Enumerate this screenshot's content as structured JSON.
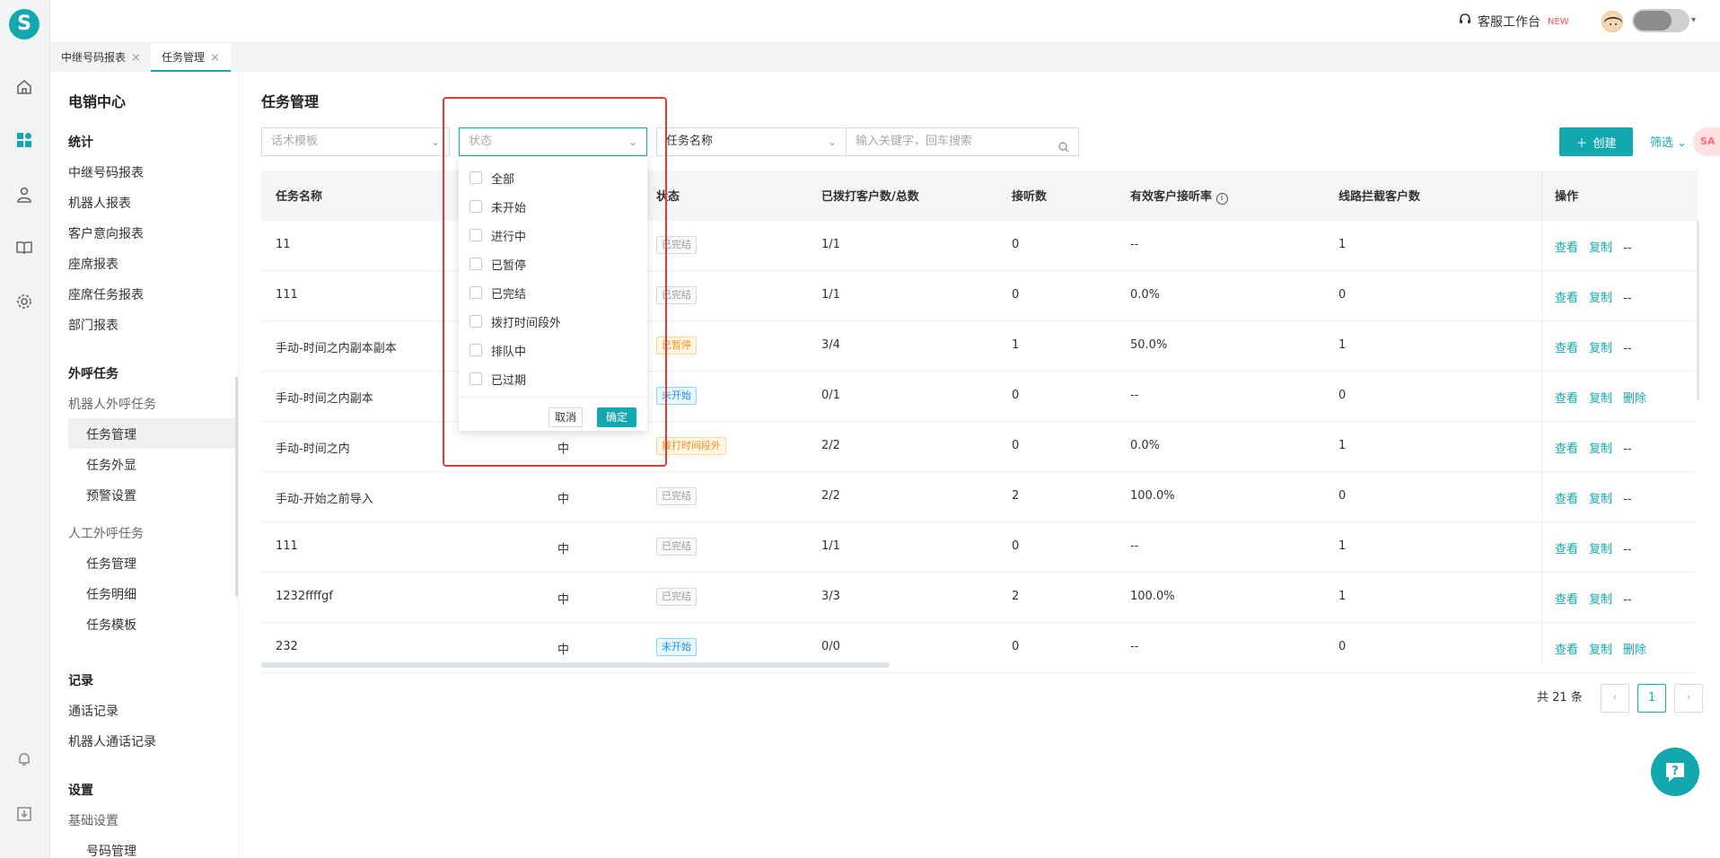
{
  "brand": {
    "logo_letter": "S",
    "accent": "#13a8b0"
  },
  "rail_icons": [
    "home-icon",
    "dashboard-icon",
    "robot-icon",
    "book-icon",
    "gear-icon",
    "bell-icon",
    "download-icon"
  ],
  "topbar": {
    "service_label": "客服工作台",
    "new_badge": "NEW"
  },
  "tabs": [
    {
      "label": "中继号码报表",
      "close": "×"
    },
    {
      "label": "任务管理",
      "close": "×"
    }
  ],
  "sidebar": {
    "title": "电销中心",
    "groups": {
      "stats": "统计",
      "stats_items": [
        "中继号码报表",
        "机器人报表",
        "客户意向报表",
        "座席报表",
        "座席任务报表",
        "部门报表"
      ],
      "outbound": "外呼任务",
      "robot_outbound": "机器人外呼任务",
      "robot_items": [
        "任务管理",
        "任务外显",
        "预警设置"
      ],
      "manual_outbound": "人工外呼任务",
      "manual_items": [
        "任务管理",
        "任务明细",
        "任务模板"
      ],
      "records": "记录",
      "records_items": [
        "通话记录",
        "机器人通话记录"
      ],
      "settings": "设置",
      "basic_settings": "基础设置",
      "basic_items": [
        "号码管理"
      ]
    }
  },
  "main": {
    "title": "任务管理",
    "filters": {
      "script_template": "话术模板",
      "status": "状态",
      "task_name": "任务名称",
      "search_placeholder": "输入关键字，回车搜索"
    },
    "create_label": "创建",
    "filter_label": "筛选",
    "float_tag": "SA"
  },
  "table": {
    "headers": [
      "任务名称",
      "状态",
      "已拨打客户数/总数",
      "接听数",
      "有效客户接听率",
      "线路拦截客户数",
      "操作"
    ],
    "rows": [
      {
        "name": "11",
        "priority": "",
        "status": "已完结",
        "status_type": "done",
        "dialed": "1/1",
        "answered": "0",
        "rate": "--",
        "blocked": "1",
        "ops": [
          "查看",
          "复制",
          "--"
        ]
      },
      {
        "name": "111",
        "priority": "",
        "status": "已完结",
        "status_type": "done",
        "dialed": "1/1",
        "answered": "0",
        "rate": "0.0%",
        "blocked": "0",
        "ops": [
          "查看",
          "复制",
          "--"
        ]
      },
      {
        "name": "手动-时间之内副本副本",
        "priority": "",
        "status": "已暂停",
        "status_type": "paused",
        "dialed": "3/4",
        "answered": "1",
        "rate": "50.0%",
        "blocked": "1",
        "ops": [
          "查看",
          "复制",
          "--"
        ]
      },
      {
        "name": "手动-时间之内副本",
        "priority": "",
        "status": "未开始",
        "status_type": "notstart",
        "dialed": "0/1",
        "answered": "0",
        "rate": "--",
        "blocked": "0",
        "ops": [
          "查看",
          "复制",
          "删除"
        ]
      },
      {
        "name": "手动-时间之内",
        "priority": "中",
        "status": "拨打时间段外",
        "status_type": "outside",
        "dialed": "2/2",
        "answered": "0",
        "rate": "0.0%",
        "blocked": "1",
        "ops": [
          "查看",
          "复制",
          "--"
        ]
      },
      {
        "name": "手动-开始之前导入",
        "priority": "中",
        "status": "已完结",
        "status_type": "done",
        "dialed": "2/2",
        "answered": "2",
        "rate": "100.0%",
        "blocked": "0",
        "ops": [
          "查看",
          "复制",
          "--"
        ]
      },
      {
        "name": "111",
        "priority": "中",
        "status": "已完结",
        "status_type": "done",
        "dialed": "1/1",
        "answered": "0",
        "rate": "--",
        "blocked": "1",
        "ops": [
          "查看",
          "复制",
          "--"
        ]
      },
      {
        "name": "1232ffffgf",
        "priority": "中",
        "status": "已完结",
        "status_type": "done",
        "dialed": "3/3",
        "answered": "2",
        "rate": "100.0%",
        "blocked": "1",
        "ops": [
          "查看",
          "复制",
          "--"
        ]
      },
      {
        "name": "232",
        "priority": "中",
        "status": "未开始",
        "status_type": "notstart",
        "dialed": "0/0",
        "answered": "0",
        "rate": "--",
        "blocked": "0",
        "ops": [
          "查看",
          "复制",
          "删除"
        ]
      }
    ]
  },
  "pagination": {
    "total": "共 21 条",
    "current": "1",
    "prev": "‹",
    "next": "›"
  },
  "status_dropdown": {
    "options": [
      "全部",
      "未开始",
      "进行中",
      "已暂停",
      "已完结",
      "拨打时间段外",
      "排队中",
      "已过期"
    ],
    "cancel": "取消",
    "confirm": "确定"
  }
}
